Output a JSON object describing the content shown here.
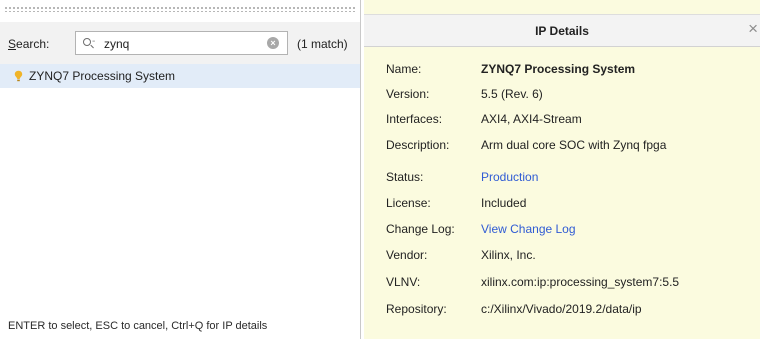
{
  "search_panel": {
    "search_label_prefix": "S",
    "search_label_rest": "earch:",
    "search_value": "zynq",
    "match_count": "(1 match)",
    "results": [
      {
        "label": "ZYNQ7 Processing System"
      }
    ],
    "hint": "ENTER to select, ESC to cancel, Ctrl+Q for IP details"
  },
  "details_panel": {
    "title": "IP Details",
    "close_glyph": "×",
    "fields": [
      {
        "label": "Name:",
        "value": "ZYNQ7 Processing System"
      },
      {
        "label": "Version:",
        "value": "5.5 (Rev. 6)"
      },
      {
        "label": "Interfaces:",
        "value": "AXI4, AXI4-Stream"
      },
      {
        "label": "Description:",
        "value": "Arm dual core SOC with Zynq fpga"
      },
      {
        "label": "Status:",
        "value": "Production"
      },
      {
        "label": "License:",
        "value": "Included"
      },
      {
        "label": "Change Log:",
        "value": "View Change Log"
      },
      {
        "label": "Vendor:",
        "value": "Xilinx, Inc."
      },
      {
        "label": "VLNV:",
        "value": "xilinx.com:ip:processing_system7:5.5"
      },
      {
        "label": "Repository:",
        "value": "c:/Xilinx/Vivado/2019.2/data/ip"
      }
    ]
  },
  "colors": {
    "selection": "#e2ecf8",
    "details_background": "#fbfbdf",
    "link": "#2f5bd4",
    "ip_icon": "#f0b429"
  }
}
